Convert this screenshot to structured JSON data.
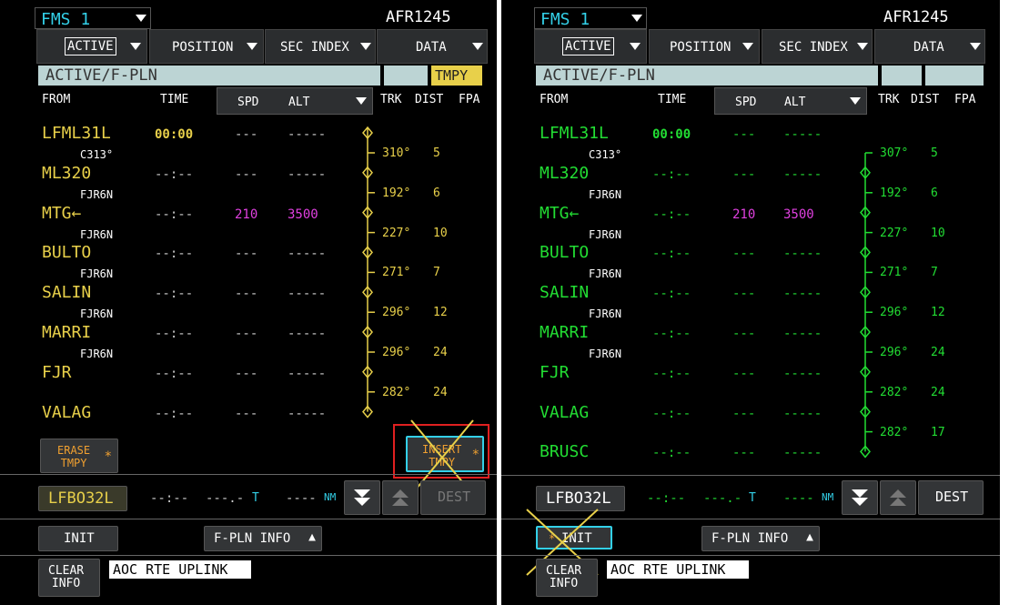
{
  "colors": {
    "yellow": "#e8d04a",
    "green": "#22dd33",
    "magenta": "#e040e0",
    "cyan": "#33d0e8",
    "orange": "#f0a030",
    "highlight_red": "#e02020"
  },
  "panels": [
    {
      "fms_label": "FMS 1",
      "flight_id": "AFR1245",
      "tabs": [
        "ACTIVE",
        "POSITION",
        "SEC INDEX",
        "DATA"
      ],
      "title": "ACTIVE/F-PLN",
      "tmpy_badge": "TMPY",
      "headers": {
        "from": "FROM",
        "time": "TIME",
        "spd": "SPD",
        "alt": "ALT",
        "trk": "TRK",
        "dist": "DIST",
        "fpa": "FPA"
      },
      "waypoints": [
        {
          "name": "LFML31L",
          "time": "00:00",
          "spd": "---",
          "alt": "-----"
        },
        {
          "name": "ML320",
          "time": "--:--",
          "spd": "---",
          "alt": "-----"
        },
        {
          "name": "MTG←",
          "time": "--:--",
          "spd": "210",
          "alt": "3500"
        },
        {
          "name": "BULTO",
          "time": "--:--",
          "spd": "---",
          "alt": "-----"
        },
        {
          "name": "SALIN",
          "time": "--:--",
          "spd": "---",
          "alt": "-----"
        },
        {
          "name": "MARRI",
          "time": "--:--",
          "spd": "---",
          "alt": "-----"
        },
        {
          "name": "FJR",
          "time": "--:--",
          "spd": "---",
          "alt": "-----"
        },
        {
          "name": "VALAG",
          "time": "--:--",
          "spd": "---",
          "alt": "-----"
        }
      ],
      "legs": [
        {
          "via": "C313°",
          "trk": "310°",
          "dist": "5"
        },
        {
          "via": "FJR6N",
          "trk": "192°",
          "dist": "6"
        },
        {
          "via": "FJR6N",
          "trk": "227°",
          "dist": "10"
        },
        {
          "via": "FJR6N",
          "trk": "271°",
          "dist": "7"
        },
        {
          "via": "FJR6N",
          "trk": "296°",
          "dist": "12"
        },
        {
          "via": "FJR6N",
          "trk": "296°",
          "dist": "24"
        },
        {
          "via": "",
          "trk": "282°",
          "dist": "24"
        }
      ],
      "erase_tmpy": "ERASE\nTMPY",
      "insert_tmpy": "INSERT\nTMPY",
      "dest": {
        "name": "LFBO32L",
        "time": "--:--",
        "spd": "---.-",
        "spd_unit": "T",
        "dist": "----",
        "dist_unit": "NM",
        "button": "DEST"
      },
      "init": "INIT",
      "fpln_info": "F-PLN INFO",
      "clear_info": "CLEAR\nINFO",
      "message": "AOC RTE UPLINK"
    },
    {
      "fms_label": "FMS 1",
      "flight_id": "AFR1245",
      "tabs": [
        "ACTIVE",
        "POSITION",
        "SEC INDEX",
        "DATA"
      ],
      "title": "ACTIVE/F-PLN",
      "headers": {
        "from": "FROM",
        "time": "TIME",
        "spd": "SPD",
        "alt": "ALT",
        "trk": "TRK",
        "dist": "DIST",
        "fpa": "FPA"
      },
      "waypoints": [
        {
          "name": "LFML31L",
          "time": "00:00",
          "spd": "---",
          "alt": "-----"
        },
        {
          "name": "ML320",
          "time": "--:--",
          "spd": "---",
          "alt": "-----"
        },
        {
          "name": "MTG←",
          "time": "--:--",
          "spd": "210",
          "alt": "3500"
        },
        {
          "name": "BULTO",
          "time": "--:--",
          "spd": "---",
          "alt": "-----"
        },
        {
          "name": "SALIN",
          "time": "--:--",
          "spd": "---",
          "alt": "-----"
        },
        {
          "name": "MARRI",
          "time": "--:--",
          "spd": "---",
          "alt": "-----"
        },
        {
          "name": "FJR",
          "time": "--:--",
          "spd": "---",
          "alt": "-----"
        },
        {
          "name": "VALAG",
          "time": "--:--",
          "spd": "---",
          "alt": "-----"
        },
        {
          "name": "BRUSC",
          "time": "--:--",
          "spd": "---",
          "alt": "-----"
        }
      ],
      "legs": [
        {
          "via": "C313°",
          "trk": "307°",
          "dist": "5"
        },
        {
          "via": "FJR6N",
          "trk": "192°",
          "dist": "6"
        },
        {
          "via": "FJR6N",
          "trk": "227°",
          "dist": "10"
        },
        {
          "via": "FJR6N",
          "trk": "271°",
          "dist": "7"
        },
        {
          "via": "FJR6N",
          "trk": "296°",
          "dist": "12"
        },
        {
          "via": "FJR6N",
          "trk": "296°",
          "dist": "24"
        },
        {
          "via": "",
          "trk": "282°",
          "dist": "24"
        },
        {
          "via": "",
          "trk": "282°",
          "dist": "17"
        }
      ],
      "dest": {
        "name": "LFBO32L",
        "time": "--:--",
        "spd": "---.-",
        "spd_unit": "T",
        "dist": "----",
        "dist_unit": "NM",
        "button": "DEST"
      },
      "init": "INIT",
      "fpln_info": "F-PLN INFO",
      "clear_info": "CLEAR\nINFO",
      "message": "AOC RTE UPLINK"
    }
  ]
}
